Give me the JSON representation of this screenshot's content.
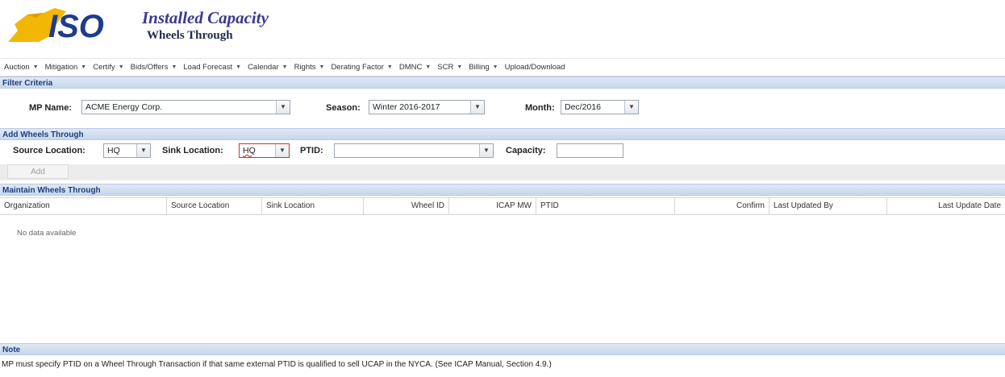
{
  "header": {
    "logo_text": "ISO",
    "title": "Installed Capacity",
    "subtitle": "Wheels Through"
  },
  "menu": [
    {
      "label": "Auction",
      "dropdown": true
    },
    {
      "label": "Mitigation",
      "dropdown": true
    },
    {
      "label": "Certify",
      "dropdown": true
    },
    {
      "label": "Bids/Offers",
      "dropdown": true
    },
    {
      "label": "Load Forecast",
      "dropdown": true
    },
    {
      "label": "Calendar",
      "dropdown": true
    },
    {
      "label": "Rights",
      "dropdown": true
    },
    {
      "label": "Derating Factor",
      "dropdown": true
    },
    {
      "label": "DMNC",
      "dropdown": true
    },
    {
      "label": "SCR",
      "dropdown": true
    },
    {
      "label": "Billing",
      "dropdown": true
    },
    {
      "label": "Upload/Download",
      "dropdown": false
    }
  ],
  "filter": {
    "section_title": "Filter Criteria",
    "mp_name_label": "MP Name:",
    "mp_name_value": "ACME Energy Corp.",
    "season_label": "Season:",
    "season_value": "Winter 2016-2017",
    "month_label": "Month:",
    "month_value": "Dec/2016"
  },
  "add": {
    "section_title": "Add Wheels Through",
    "source_label": "Source Location:",
    "source_value": "HQ",
    "sink_label": "Sink Location:",
    "sink_value": "HQ",
    "ptid_label": "PTID:",
    "ptid_value": "",
    "capacity_label": "Capacity:",
    "capacity_value": "",
    "add_button": "Add"
  },
  "maintain": {
    "section_title": "Maintain Wheels Through",
    "columns": [
      "Organization",
      "Source Location",
      "Sink Location",
      "Wheel ID",
      "ICAP MW",
      "PTID",
      "Confirm",
      "Last Updated By",
      "Last Update Date"
    ],
    "empty_text": "No data available"
  },
  "note": {
    "section_title": "Note",
    "text": "MP must specify PTID on a Wheel Through Transaction if that same external PTID is qualified to sell UCAP in the NYCA. (See ICAP Manual, Section 4.9.)"
  },
  "colors": {
    "section_header_text": "#1f3f7a",
    "logo_yellow": "#f2b705",
    "logo_blue": "#1f3c8a",
    "focused_border": "#cc3333"
  }
}
